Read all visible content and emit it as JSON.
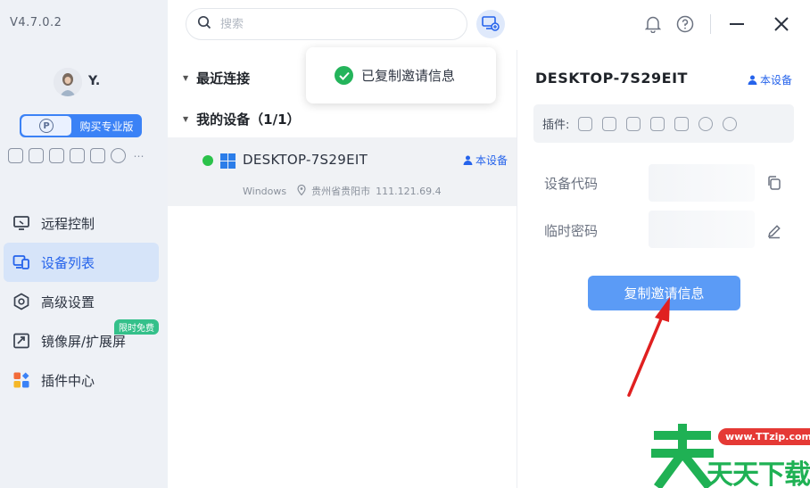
{
  "app": {
    "version": "V4.7.0.2"
  },
  "user": {
    "name": "Y."
  },
  "sidebar": {
    "buy_pro_label": "购买专业版",
    "pro_badge": "P",
    "nav": [
      {
        "label": "远程控制"
      },
      {
        "label": "设备列表"
      },
      {
        "label": "高级设置"
      },
      {
        "label": "镜像屏/扩展屏",
        "badge": "限时免费"
      },
      {
        "label": "插件中心"
      }
    ]
  },
  "search": {
    "placeholder": "搜索"
  },
  "toast": {
    "message": "已复制邀请信息"
  },
  "device_list": {
    "recent_label": "最近连接",
    "my_devices_label": "我的设备（1/1）",
    "device": {
      "name": "DESKTOP-7S29EIT",
      "tag": "本设备",
      "os": "Windows",
      "location": "贵州省贵阳市",
      "ip": "111.121.69.4"
    }
  },
  "detail": {
    "title": "DESKTOP-7S29EIT",
    "tag": "本设备",
    "plugins_label": "插件:",
    "device_code_label": "设备代码",
    "temp_password_label": "临时密码",
    "copy_invite_label": "复制邀请信息"
  },
  "watermark": {
    "url": "www.TTzip.com",
    "text": "天天下载"
  },
  "colors": {
    "accent": "#2563eb",
    "button": "#5b9bf6",
    "online": "#2bc24a",
    "toast_check": "#24b45b"
  }
}
